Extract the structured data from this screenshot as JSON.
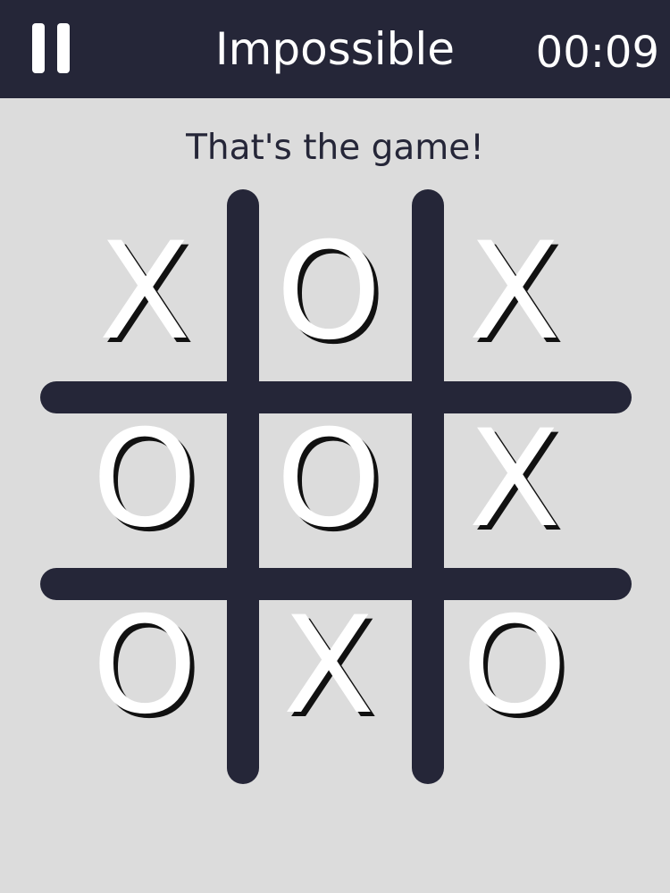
{
  "header": {
    "pause_icon": "pause-icon",
    "title": "Impossible",
    "timer": "00:09"
  },
  "status": {
    "message": "That's the game!"
  },
  "board": {
    "cells": [
      "X",
      "O",
      "X",
      "O",
      "O",
      "X",
      "O",
      "X",
      "O"
    ]
  },
  "colors": {
    "header_bg": "#252638",
    "page_bg": "#dcdcdc",
    "grid": "#252638",
    "mark": "#ffffff",
    "text": "#252638"
  }
}
